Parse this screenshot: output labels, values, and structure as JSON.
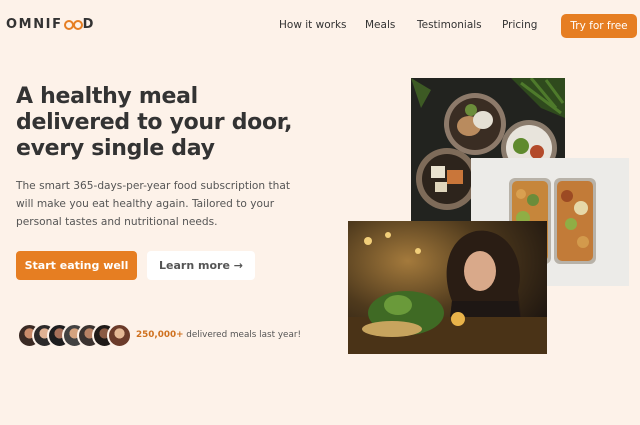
{
  "header": {
    "logo_text_start": "OMNIF",
    "logo_text_end": "D",
    "nav": [
      {
        "label": "How it works"
      },
      {
        "label": "Meals"
      },
      {
        "label": "Testimonials"
      },
      {
        "label": "Pricing"
      }
    ],
    "cta_label": "Try for free"
  },
  "hero": {
    "title_line1": "A healthy meal",
    "title_line2": "delivered to your door,",
    "title_line3": "every single day",
    "description": "The smart 365-days-per-year food subscription that will make you eat healthy again. Tailored to your personal tastes and nutritional needs.",
    "primary_button": "Start eating well",
    "secondary_button": "Learn more →"
  },
  "delivered": {
    "count": "250,000+",
    "text": " delivered meals last year!"
  },
  "colors": {
    "accent": "#e67e22",
    "background": "#fdf2e9"
  },
  "icons": {
    "logo_oo": "fork-plate-circles-icon",
    "arrow": "arrow-right-icon"
  }
}
